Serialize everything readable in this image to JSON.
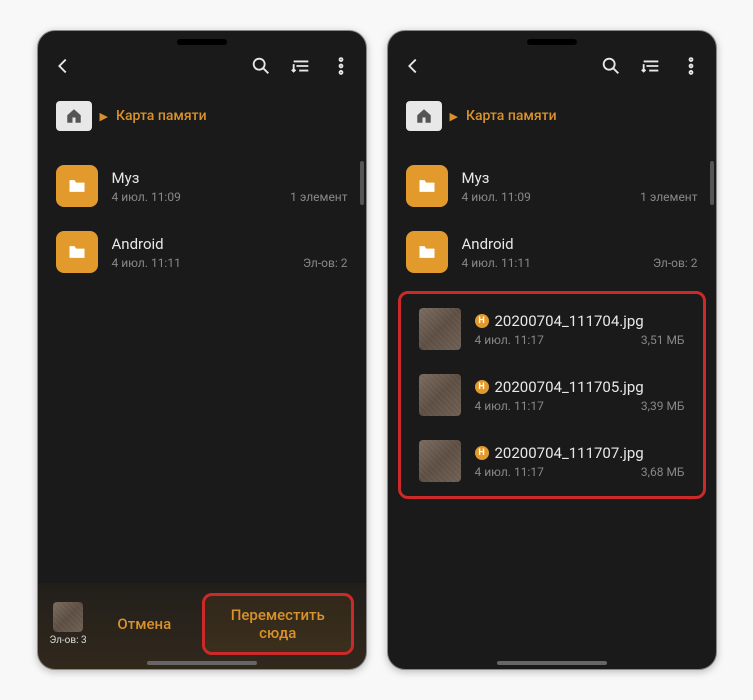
{
  "breadcrumb": {
    "label": "Карта памяти"
  },
  "folders": [
    {
      "name": "Муз",
      "date": "4 июл. 11:09",
      "meta": "1 элемент"
    },
    {
      "name": "Android",
      "date": "4 июл. 11:11",
      "meta": "Эл-ов: 2"
    }
  ],
  "files": [
    {
      "badge": "H",
      "name": "20200704_111704.jpg",
      "date": "4 июл. 11:17",
      "size": "3,51 МБ"
    },
    {
      "badge": "H",
      "name": "20200704_111705.jpg",
      "date": "4 июл. 11:17",
      "size": "3,39 МБ"
    },
    {
      "badge": "H",
      "name": "20200704_111707.jpg",
      "date": "4 июл. 11:17",
      "size": "3,68 МБ"
    }
  ],
  "clipboard": {
    "count_label": "Эл-ов: 3"
  },
  "actions": {
    "cancel": "Отмена",
    "move_here": "Переместить сюда"
  }
}
